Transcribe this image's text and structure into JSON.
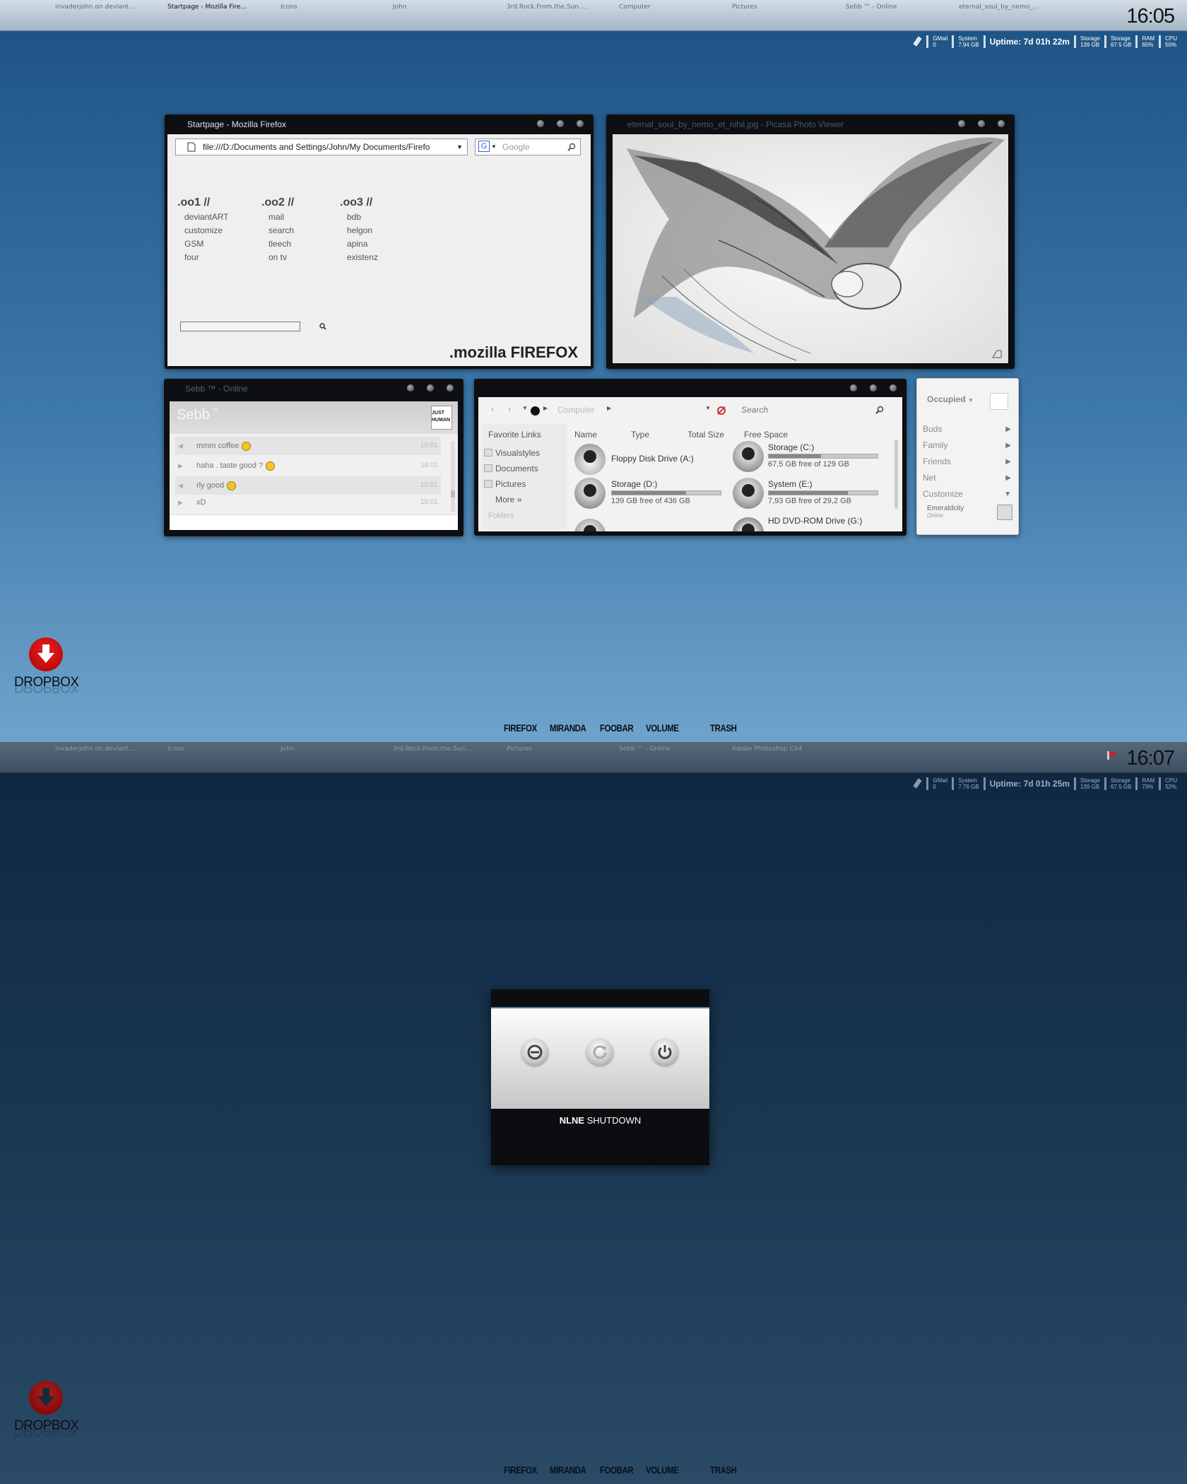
{
  "screen1": {
    "taskbar": {
      "tasks": [
        "invaderjohn on deviant...",
        "Startpage - Mozilla Fire...",
        "Icons",
        "John",
        "3rd.Rock.From.the.Sun....",
        "Computer",
        "Pictures",
        "Sebb ™ - Online",
        "eternal_soul_by_nemo_..."
      ],
      "clock": "16:05"
    },
    "stats": {
      "gmail_label": "GMail",
      "gmail_value": "0",
      "system_label": "System",
      "system_value": "7.94 GB",
      "uptime": "Uptime: 7d 01h 22m",
      "storage1_label": "Storage",
      "storage1_value": "139 GB",
      "storage2_label": "Storage",
      "storage2_value": "67.5 GB",
      "ram_label": "RAM",
      "ram_value": "65%",
      "cpu_label": "CPU",
      "cpu_value": "50%"
    },
    "firefox": {
      "title": "Startpage - Mozilla Firefox",
      "url": "file:///D:/Documents and Settings/John/My Documents/Firefo",
      "search_placeholder": "Google",
      "col1": {
        "title": ".oo1 //",
        "links": [
          "deviantART",
          "customize",
          "GSM",
          "four"
        ]
      },
      "col2": {
        "title": ".oo2 //",
        "links": [
          "mail",
          "search",
          "tleech",
          "on tv"
        ]
      },
      "col3": {
        "title": ".oo3 //",
        "links": [
          "bdb",
          "helgon",
          "apina",
          "existenz"
        ]
      },
      "brand": ".mozilla FIREFOX"
    },
    "picasa": {
      "title": "eternal_soul_by_nemo_et_nihil.jpg - Picasa Photo Viewer"
    },
    "chat": {
      "title": "Sebb ™ - Online",
      "contact": "Sebb ˇ",
      "avatar_text": "JUST HUMAN",
      "messages": [
        {
          "text": "mmm coffee",
          "time": "16:01"
        },
        {
          "text": "haha . taste good ?",
          "time": "16:01"
        },
        {
          "text": "rly good",
          "time": "16:01"
        },
        {
          "text": "xD",
          "time": "16:01"
        }
      ]
    },
    "explorer": {
      "breadcrumb": "Computer",
      "search_placeholder": "Search",
      "favorites_title": "Favorite Links",
      "favorites": [
        "Visualstyles",
        "Documents",
        "Pictures"
      ],
      "more": "More",
      "folders": "Folders",
      "columns": [
        "Name",
        "Type",
        "Total Size",
        "Free Space"
      ],
      "drives": [
        {
          "name": "Floppy Disk Drive (A:)",
          "free": "",
          "used_fraction": 0
        },
        {
          "name": "Storage (C:)",
          "free": "67,5 GB free of 129 GB",
          "used_fraction": 0.48
        },
        {
          "name": "Storage (D:)",
          "free": "139 GB free of 436 GB",
          "used_fraction": 0.68
        },
        {
          "name": "System (E:)",
          "free": "7,93 GB free of 29,2 GB",
          "used_fraction": 0.73
        },
        {
          "name": "HD DVD-ROM Drive (G:)",
          "free": "",
          "used_fraction": 0
        }
      ]
    },
    "miranda": {
      "status": "Occupied",
      "groups": [
        "Buds",
        "Family",
        "Friends",
        "Net",
        "Customize"
      ],
      "account": "Emeraldcity",
      "account_status": "Online"
    }
  },
  "screen2": {
    "taskbar": {
      "tasks": [
        "invaderjohn on deviant...",
        "Icons",
        "John",
        "3rd.Rock.From.the.Sun....",
        "Pictures",
        "Sebb ™ - Online",
        "Adobe Photoshop CS4"
      ],
      "clock": "16:07"
    },
    "stats": {
      "gmail_label": "GMail",
      "gmail_value": "0",
      "system_label": "System",
      "system_value": "7.76 GB",
      "uptime": "Uptime: 7d 01h 25m",
      "storage1_label": "Storage",
      "storage1_value": "139 GB",
      "storage2_label": "Storage",
      "storage2_value": "67.5 GB",
      "ram_label": "RAM",
      "ram_value": "73%",
      "cpu_label": "CPU",
      "cpu_value": "52%"
    },
    "shutdown": {
      "title_bold": "NLNE",
      "title": "SHUTDOWN"
    }
  },
  "dock": [
    "FIREFOX",
    "MIRANDA",
    "FOOBAR",
    "VOLUME",
    "TRASH"
  ],
  "dropbox_label": "DROPBOX",
  "colors": {
    "accent": "#3d78aa",
    "window": "#0d0f12",
    "dropbox": "#d41010"
  }
}
